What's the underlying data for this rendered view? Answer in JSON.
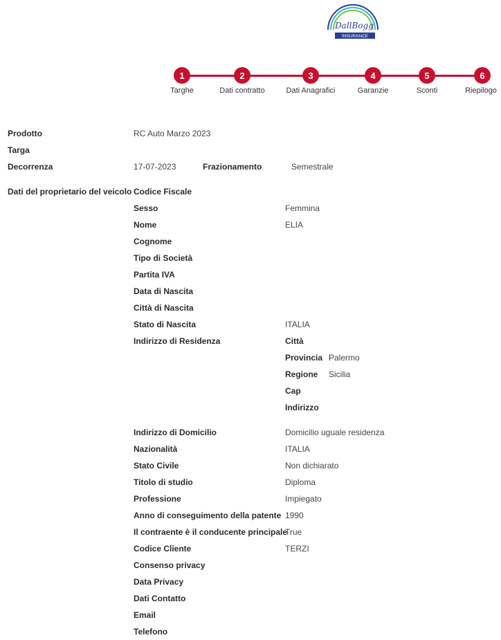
{
  "brand": {
    "script": "DallBogg",
    "tag": "INSURANCE"
  },
  "stepper": {
    "steps": [
      {
        "number": "1",
        "label": "Targhe"
      },
      {
        "number": "2",
        "label": "Dati contratto"
      },
      {
        "number": "3",
        "label": "Dati Anagrafici"
      },
      {
        "number": "4",
        "label": "Garanzie"
      },
      {
        "number": "5",
        "label": "Sconti"
      },
      {
        "number": "6",
        "label": "Riepilogo"
      }
    ]
  },
  "summary": {
    "prodotto_label": "Prodotto",
    "prodotto_value": "RC Auto Marzo 2023",
    "targa_label": "Targa",
    "decorrenza_label": "Decorrenza",
    "decorrenza_value": "17-07-2023",
    "frazionamento_label": "Frazionamento",
    "frazionamento_value": "Semestrale"
  },
  "owner": {
    "section_label": "Dati del proprietario del veicolo",
    "fields": [
      {
        "label": "Codice Fiscale",
        "value": ""
      },
      {
        "label": "Sesso",
        "value": "Femmina"
      },
      {
        "label": "Nome",
        "value": "ELIA"
      },
      {
        "label": "Cognome",
        "value": ""
      },
      {
        "label": "Tipo di Società",
        "value": ""
      },
      {
        "label": "Partita IVA",
        "value": ""
      },
      {
        "label": "Data di Nascita",
        "value": ""
      },
      {
        "label": "Città di Nascita",
        "value": ""
      },
      {
        "label": "Stato di Nascita",
        "value": "ITALIA"
      },
      {
        "label": "Indirizzo di Residenza",
        "value": ""
      }
    ],
    "residenza": [
      {
        "label": "Città",
        "value": ""
      },
      {
        "label": "Provincia",
        "value": "Palermo"
      },
      {
        "label": "Regione",
        "value": "Sicilia"
      },
      {
        "label": "Cap",
        "value": ""
      },
      {
        "label": "Indirizzo",
        "value": ""
      }
    ],
    "more_fields": [
      {
        "label": "Indirizzo di Domicilio",
        "value": "Domicilio uguale residenza"
      },
      {
        "label": "Nazionalità",
        "value": "ITALIA"
      },
      {
        "label": "Stato Civile",
        "value": "Non dichiarato"
      },
      {
        "label": "Titolo di studio",
        "value": "Diploma"
      },
      {
        "label": "Professione",
        "value": "Impiegato"
      },
      {
        "label": "Anno di conseguimento della patente",
        "value": "1990"
      },
      {
        "label": "Il contraente è il conducente principale",
        "value": "True"
      },
      {
        "label": "Codice Cliente",
        "value": "TERZI"
      },
      {
        "label": "Consenso privacy",
        "value": ""
      },
      {
        "label": "Data Privacy",
        "value": ""
      },
      {
        "label": "Dati Contatto",
        "value": ""
      },
      {
        "label": "Email",
        "value": ""
      },
      {
        "label": "Telefono",
        "value": ""
      }
    ]
  },
  "colors": {
    "accent": "#c8102e",
    "brand_blue": "#2c3e8f",
    "arc_green": "#7cc242",
    "arc_cyan": "#35b6e6"
  }
}
